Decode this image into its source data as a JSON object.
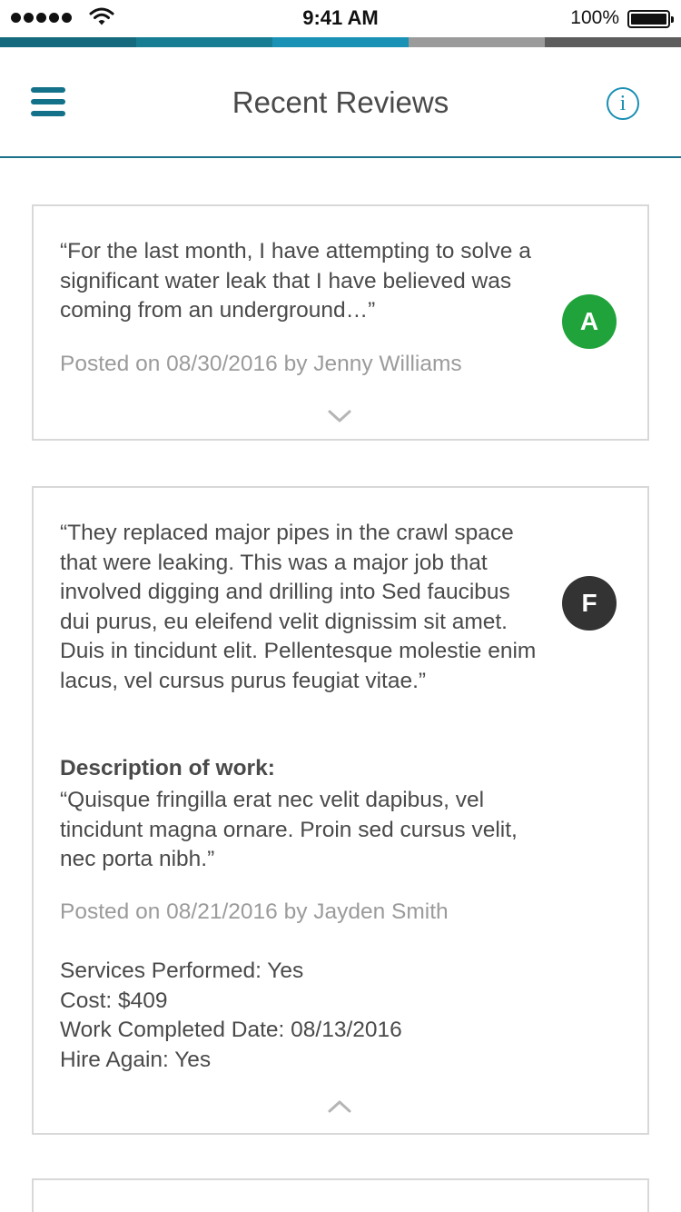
{
  "status_bar": {
    "time": "9:41 AM",
    "battery": "100%",
    "icons": [
      "signal-icon",
      "wifi-icon",
      "battery-icon"
    ]
  },
  "progress_stripe": {
    "colors": [
      "#156a7d",
      "#177d92",
      "#1a92b5",
      "#9b9b9b",
      "#5d5d5d"
    ]
  },
  "header": {
    "title": "Recent Reviews",
    "info_label": "i",
    "icons": [
      "menu-icon",
      "info-icon"
    ],
    "accent_color": "#13718a"
  },
  "reviews": [
    {
      "quote": "“For the last month, I have attempting to solve a significant water leak that I have be­lieved was coming from an underground…”",
      "grade": "A",
      "grade_color": "#1fa33a",
      "posted": "Posted on 08/30/2016 by Jenny Williams",
      "expanded": false,
      "toggle_icon": "chevron-down-icon"
    },
    {
      "quote": "“They replaced major pipes in the crawl space that were leaking. This was a major job that involved digging and drilling into Sed faucibus dui purus, eu eleifend velit dignissim sit amet. Duis in tincidunt elit. Pel­lentesque molestie enim lacus, vel cursus purus feugiat vitae.”",
      "grade": "F",
      "grade_color": "#333333",
      "description_heading": "Description of work:",
      "description": "“Quisque fringilla erat nec velit dapibus, vel tincidunt magna ornare. Proin sed cursus velit, nec porta nibh.”",
      "posted": "Posted on 08/21/2016 by Jayden Smith",
      "details": [
        "Services Performed: Yes",
        "Cost: $409",
        "Work Completed Date: 08/13/2016",
        "Hire Again: Yes"
      ],
      "expanded": true,
      "toggle_icon": "chevron-up-icon"
    }
  ]
}
